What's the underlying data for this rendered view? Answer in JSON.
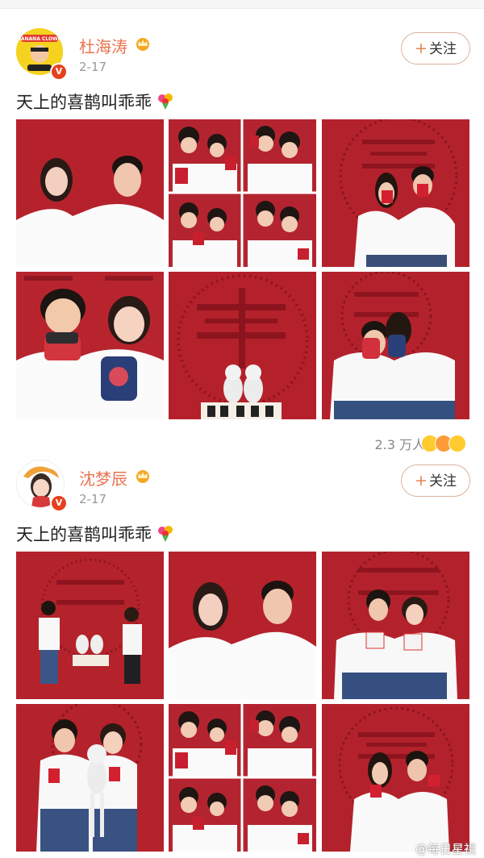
{
  "posts": [
    {
      "username": "杜海涛",
      "date": "2-17",
      "follow_label": "关注",
      "text": "天上的喜鹊叫乖乖",
      "likes": "2.3 万人",
      "avatar_text": "BANANA CLOWN"
    },
    {
      "username": "沈梦辰",
      "date": "2-17",
      "follow_label": "关注",
      "text": "天上的喜鹊叫乖乖"
    }
  ],
  "watermark": "@每日星視",
  "colors": {
    "brand_name": "#eb7350",
    "photo_red": "#b5212d",
    "follow_border": "#d9b39b"
  }
}
